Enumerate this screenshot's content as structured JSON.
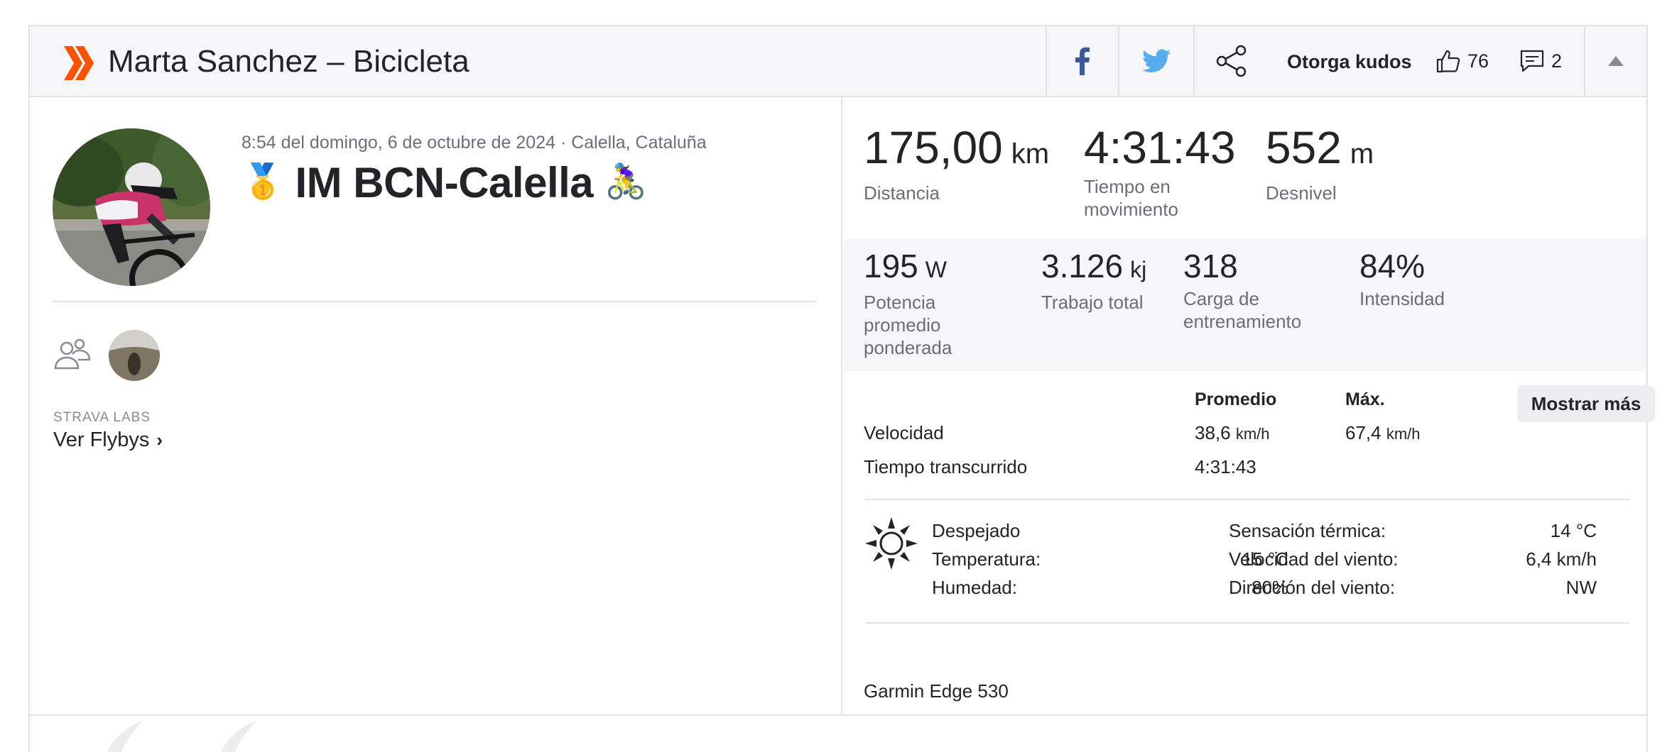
{
  "header": {
    "title": "Marta Sanchez – Bicicleta",
    "kudos_label": "Otorga kudos",
    "kudos_count": "76",
    "comment_count": "2"
  },
  "activity": {
    "datetime_location": "8:54 del domingo, 6 de octubre de 2024 · Calella, Cataluña",
    "title_prefix_emoji": "🥇",
    "title": "IM BCN-Calella",
    "title_suffix_emoji": "🚴‍♀️",
    "labs_label": "STRAVA LABS",
    "flybys_label": "Ver Flybys"
  },
  "primary_stats": [
    {
      "value": "175,00",
      "unit": "km",
      "label": "Distancia"
    },
    {
      "value": "4:31:43",
      "unit": "",
      "label": "Tiempo en movimiento"
    },
    {
      "value": "552",
      "unit": "m",
      "label": "Desnivel"
    }
  ],
  "secondary_stats": [
    {
      "value": "195",
      "unit": "W",
      "label": "Potencia promedio ponderada"
    },
    {
      "value": "3.126",
      "unit": "kj",
      "label": "Trabajo total"
    },
    {
      "value": "318",
      "unit": "",
      "label": "Carga de entrenamiento"
    },
    {
      "value": "84%",
      "unit": "",
      "label": "Intensidad"
    }
  ],
  "more_table": {
    "col_avg": "Promedio",
    "col_max": "Máx.",
    "show_more": "Mostrar más",
    "rows": [
      {
        "label": "Velocidad",
        "avg": "38,6",
        "avg_unit": "km/h",
        "max": "67,4",
        "max_unit": "km/h"
      },
      {
        "label": "Tiempo transcurrido",
        "avg": "4:31:43",
        "avg_unit": "",
        "max": "",
        "max_unit": ""
      }
    ]
  },
  "weather": {
    "condition": "Despejado",
    "left": [
      {
        "label": "Temperatura:",
        "value": "15 °C"
      },
      {
        "label": "Humedad:",
        "value": "80%"
      }
    ],
    "right": [
      {
        "label": "Sensación térmica:",
        "value": "14 °C"
      },
      {
        "label": "Velocidad del viento:",
        "value": "6,4 km/h"
      },
      {
        "label": "Dirección del viento:",
        "value": "NW"
      }
    ]
  },
  "device": "Garmin Edge 530",
  "colors": {
    "brand": "#fc5200",
    "facebook": "#3b5998",
    "twitter": "#55acee",
    "text": "#242428",
    "muted": "#6d6d78",
    "panel": "#f6f6f8"
  },
  "icons": [
    "strava-chevrons-icon",
    "facebook-icon",
    "twitter-icon",
    "share-icon",
    "thumbs-up-icon",
    "comment-icon",
    "caret-up-icon",
    "group-icon",
    "chevron-right-icon",
    "sun-icon"
  ]
}
